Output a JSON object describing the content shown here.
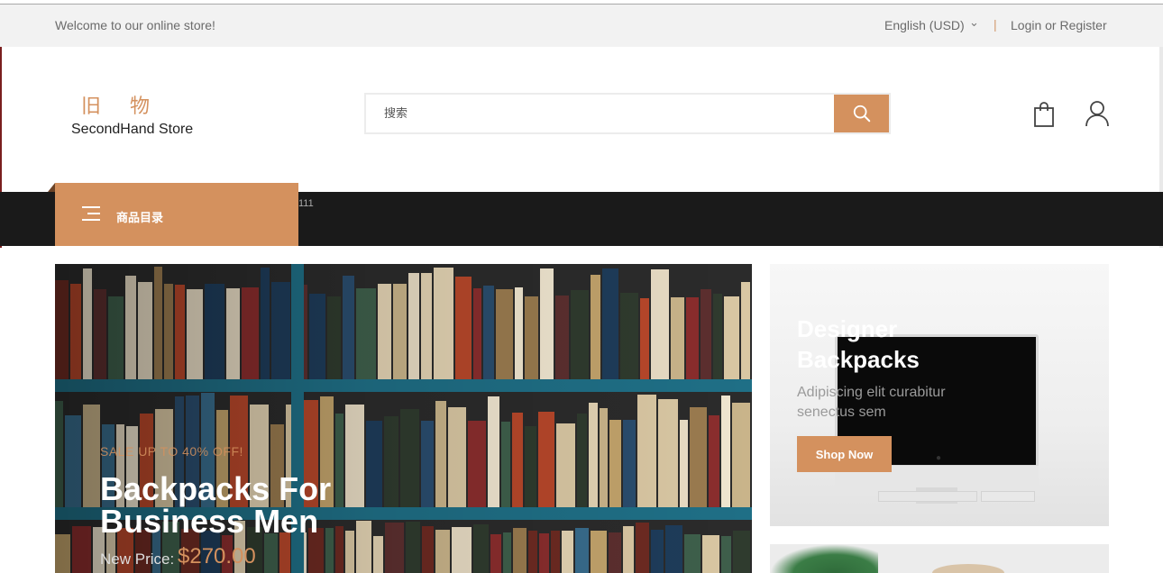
{
  "topbar": {
    "welcome": "Welcome to our online store!",
    "language": "English (USD)",
    "separator": "|",
    "login": "Login or Register"
  },
  "logo": {
    "cn": "旧物",
    "en": "SecondHand Store"
  },
  "search": {
    "placeholder": "搜索"
  },
  "nav": {
    "menu_label": "商品目录",
    "extra": "111"
  },
  "hero": {
    "sale": "SALE UP TO 40% OFF!",
    "title": "Backpacks For Business Men",
    "price_label": "New Price:",
    "price": "$270.00"
  },
  "promo1": {
    "title": "Designer Backpacks",
    "desc": "Adipiscing elit curabitur senectus sem",
    "button": "Shop Now"
  },
  "icons": {
    "search": "search-icon",
    "cart": "shopping-bag-icon",
    "account": "user-icon",
    "menu": "hamburger-icon",
    "chevron": "chevron-down-icon"
  },
  "colors": {
    "accent": "#d4915e",
    "nav_bg": "#1a1a1a",
    "topbar_bg": "#f2f2f2"
  }
}
